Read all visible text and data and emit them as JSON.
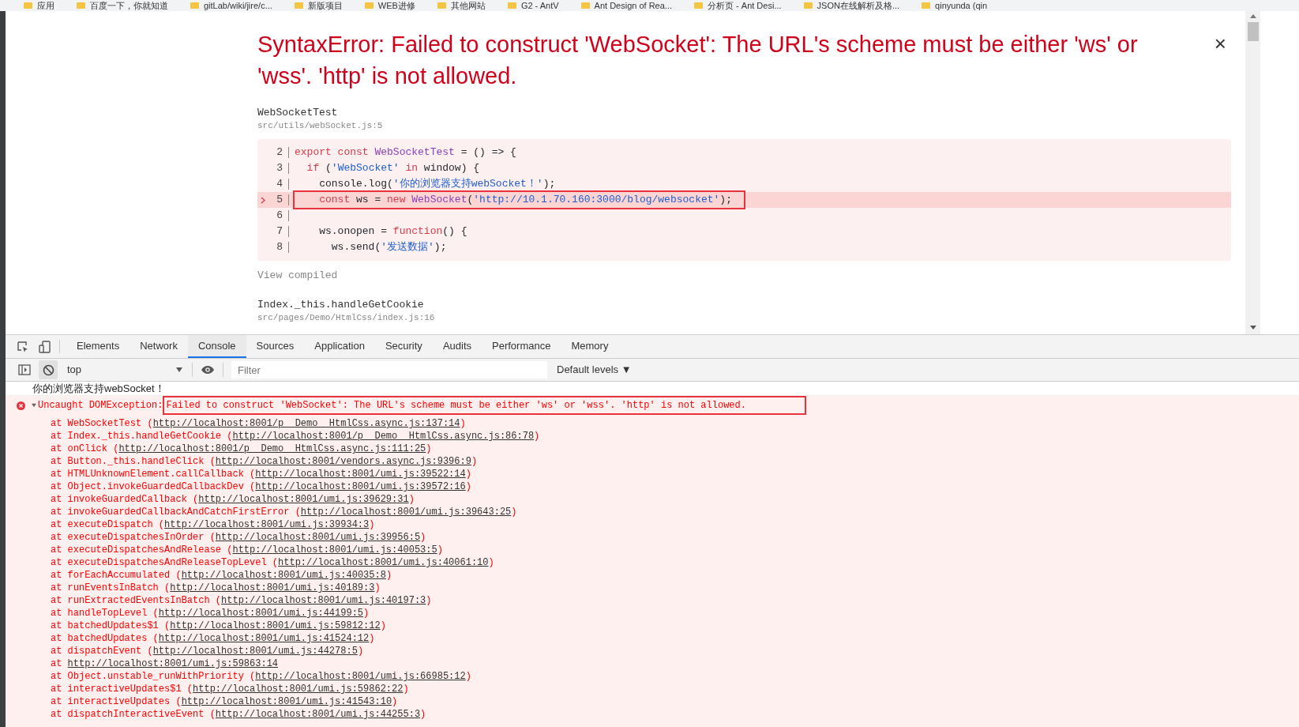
{
  "bookmarks": [
    {
      "label": "应用"
    },
    {
      "label": "百度一下，你就知道"
    },
    {
      "label": "gitLab/wiki/jire/c..."
    },
    {
      "label": "新版项目"
    },
    {
      "label": "WEB进修"
    },
    {
      "label": "其他网站"
    },
    {
      "label": "G2 - AntV"
    },
    {
      "label": "Ant Design of Rea..."
    },
    {
      "label": "分析页 - Ant Desi..."
    },
    {
      "label": "JSON在线解析及格..."
    },
    {
      "label": "qinyunda (qin"
    }
  ],
  "overlay": {
    "title": "SyntaxError: Failed to construct 'WebSocket': The URL's scheme must be either 'ws' or 'wss'. 'http' is not allowed.",
    "close": "×",
    "frames": [
      {
        "name": "WebSocketTest",
        "file": "src/utils/webSocket.js:5",
        "code": [
          {
            "number": "2",
            "highlighted": false,
            "segments": [
              {
                "kind": "keyword",
                "t": "export const"
              },
              {
                "kind": "name",
                "t": " WebSocketTest"
              },
              {
                "kind": "plain",
                "t": " = () => {"
              }
            ]
          },
          {
            "number": "3",
            "highlighted": false,
            "segments": [
              {
                "kind": "keyword",
                "t": "  if"
              },
              {
                "kind": "plain",
                "t": " ("
              },
              {
                "kind": "string",
                "t": "'WebSocket'"
              },
              {
                "kind": "keyword",
                "t": " in"
              },
              {
                "kind": "plain",
                "t": " window) {"
              }
            ]
          },
          {
            "number": "4",
            "highlighted": false,
            "segments": [
              {
                "kind": "plain",
                "t": "    console.log("
              },
              {
                "kind": "string",
                "t": "'你的浏览器支持webSocket！'"
              },
              {
                "kind": "plain",
                "t": ");"
              }
            ]
          },
          {
            "number": "5",
            "highlighted": true,
            "segments": [
              {
                "kind": "keyword",
                "t": "    const"
              },
              {
                "kind": "plain",
                "t": " ws ="
              },
              {
                "kind": "keyword",
                "t": " new"
              },
              {
                "kind": "name",
                "t": " WebSocket"
              },
              {
                "kind": "plain",
                "t": "("
              },
              {
                "kind": "string",
                "t": "'http://10.1.70.160:3000/blog/websocket'"
              },
              {
                "kind": "plain",
                "t": ");"
              }
            ]
          },
          {
            "number": "6",
            "highlighted": false
          },
          {
            "number": "7",
            "highlighted": false,
            "segments": [
              {
                "kind": "plain",
                "t": "    ws.onopen ="
              },
              {
                "kind": "keyword",
                "t": " function"
              },
              {
                "kind": "plain",
                "t": "() {"
              }
            ]
          },
          {
            "number": "8",
            "highlighted": false,
            "segments": [
              {
                "kind": "plain",
                "t": "      ws.send("
              },
              {
                "kind": "string",
                "t": "'发送数据'"
              },
              {
                "kind": "plain",
                "t": ");"
              }
            ]
          }
        ],
        "view_compiled": "View compiled"
      },
      {
        "name": "Index._this.handleGetCookie",
        "file": "src/pages/Demo/HtmlCss/index.js:16"
      }
    ]
  },
  "devtools": {
    "tabs": [
      {
        "label": "Elements",
        "selected": false
      },
      {
        "label": "Network",
        "selected": false
      },
      {
        "label": "Console",
        "selected": true
      },
      {
        "label": "Sources",
        "selected": false
      },
      {
        "label": "Application",
        "selected": false
      },
      {
        "label": "Security",
        "selected": false
      },
      {
        "label": "Audits",
        "selected": false
      },
      {
        "label": "Performance",
        "selected": false
      },
      {
        "label": "Memory",
        "selected": false
      }
    ],
    "context": "top",
    "filter": {
      "placeholder": "Filter"
    },
    "levels": "Default levels ▼",
    "log": "你的浏览器支持webSocket！",
    "exception": {
      "label": "Uncaught DOMException:",
      "message": "Failed to construct 'WebSocket': The URL's scheme must be either 'ws' or 'wss'. 'http' is not allowed.",
      "expanded": true,
      "stack": [
        {
          "call": "at WebSocketTest (",
          "url": "http://localhost:8001/p__Demo__HtmlCss.async.js:137:14",
          "end": ")"
        },
        {
          "call": "at Index._this.handleGetCookie (",
          "url": "http://localhost:8001/p__Demo__HtmlCss.async.js:86:78",
          "end": ")"
        },
        {
          "call": "at onClick (",
          "url": "http://localhost:8001/p__Demo__HtmlCss.async.js:111:25",
          "end": ")"
        },
        {
          "call": "at Button._this.handleClick (",
          "url": "http://localhost:8001/vendors.async.js:9396:9",
          "end": ")"
        },
        {
          "call": "at HTMLUnknownElement.callCallback (",
          "url": "http://localhost:8001/umi.js:39522:14",
          "end": ")"
        },
        {
          "call": "at Object.invokeGuardedCallbackDev (",
          "url": "http://localhost:8001/umi.js:39572:16",
          "end": ")"
        },
        {
          "call": "at invokeGuardedCallback (",
          "url": "http://localhost:8001/umi.js:39629:31",
          "end": ")"
        },
        {
          "call": "at invokeGuardedCallbackAndCatchFirstError (",
          "url": "http://localhost:8001/umi.js:39643:25",
          "end": ")"
        },
        {
          "call": "at executeDispatch (",
          "url": "http://localhost:8001/umi.js:39934:3",
          "end": ")"
        },
        {
          "call": "at executeDispatchesInOrder (",
          "url": "http://localhost:8001/umi.js:39956:5",
          "end": ")"
        },
        {
          "call": "at executeDispatchesAndRelease (",
          "url": "http://localhost:8001/umi.js:40053:5",
          "end": ")"
        },
        {
          "call": "at executeDispatchesAndReleaseTopLevel (",
          "url": "http://localhost:8001/umi.js:40061:10",
          "end": ")"
        },
        {
          "call": "at forEachAccumulated (",
          "url": "http://localhost:8001/umi.js:40035:8",
          "end": ")"
        },
        {
          "call": "at runEventsInBatch (",
          "url": "http://localhost:8001/umi.js:40189:3",
          "end": ")"
        },
        {
          "call": "at runExtractedEventsInBatch (",
          "url": "http://localhost:8001/umi.js:40197:3",
          "end": ")"
        },
        {
          "call": "at handleTopLevel (",
          "url": "http://localhost:8001/umi.js:44199:5",
          "end": ")"
        },
        {
          "call": "at batchedUpdates$1 (",
          "url": "http://localhost:8001/umi.js:59812:12",
          "end": ")"
        },
        {
          "call": "at batchedUpdates (",
          "url": "http://localhost:8001/umi.js:41524:12",
          "end": ")"
        },
        {
          "call": "at dispatchEvent (",
          "url": "http://localhost:8001/umi.js:44278:5",
          "end": ")"
        },
        {
          "call": "at ",
          "url": "http://localhost:8001/umi.js:59863:14"
        },
        {
          "call": "at Object.unstable_runWithPriority (",
          "url": "http://localhost:8001/umi.js:66985:12",
          "end": ")"
        },
        {
          "call": "at interactiveUpdates$1 (",
          "url": "http://localhost:8001/umi.js:59862:22",
          "end": ")"
        },
        {
          "call": "at interactiveUpdates (",
          "url": "http://localhost:8001/umi.js:41543:10",
          "end": ")"
        },
        {
          "call": "at dispatchInteractiveEvent (",
          "url": "http://localhost:8001/umi.js:44255:3",
          "end": ")"
        }
      ]
    }
  }
}
